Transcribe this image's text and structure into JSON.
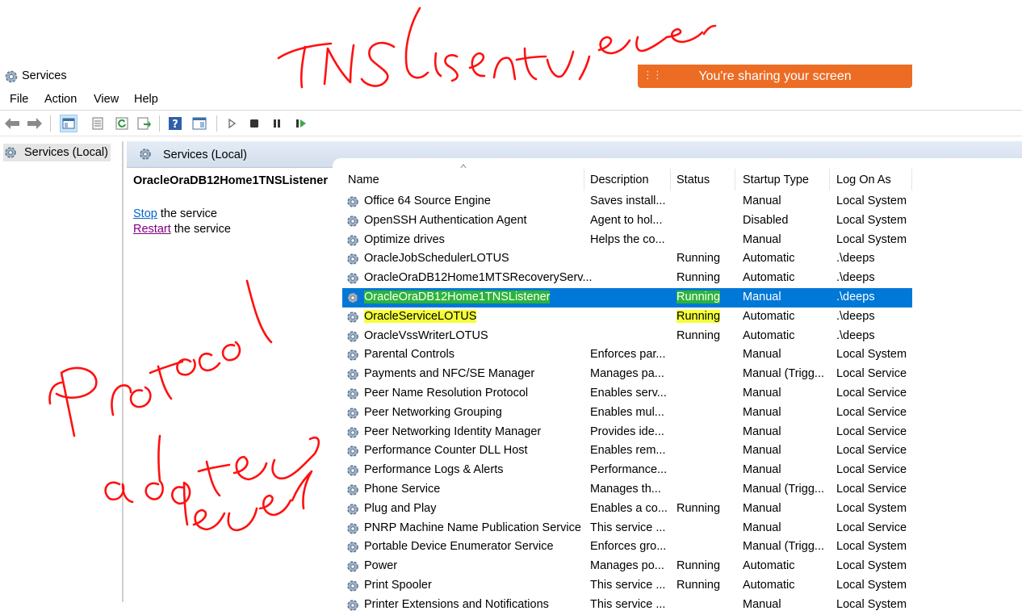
{
  "window": {
    "title": "Services"
  },
  "share_banner": {
    "text": "You're sharing your screen"
  },
  "menu": {
    "items": [
      "File",
      "Action",
      "View",
      "Help"
    ]
  },
  "tree": {
    "root": "Services (Local)"
  },
  "panel": {
    "title": "Services (Local)"
  },
  "extended": {
    "service_name": "OracleOraDB12Home1TNSListener",
    "stop_link": "Stop",
    "stop_suffix": " the service",
    "restart_link": "Restart",
    "restart_suffix": " the service"
  },
  "columns": [
    "Name",
    "Description",
    "Status",
    "Startup Type",
    "Log On As"
  ],
  "rows": [
    {
      "name": "Office 64 Source Engine",
      "desc": "Saves install...",
      "status": "",
      "startup": "Manual",
      "logon": "Local System"
    },
    {
      "name": "OpenSSH Authentication Agent",
      "desc": "Agent to hol...",
      "status": "",
      "startup": "Disabled",
      "logon": "Local System"
    },
    {
      "name": "Optimize drives",
      "desc": "Helps the co...",
      "status": "",
      "startup": "Manual",
      "logon": "Local System"
    },
    {
      "name": "OracleJobSchedulerLOTUS",
      "desc": "",
      "status": "Running",
      "startup": "Automatic",
      "logon": ".\\deeps"
    },
    {
      "name": "OracleOraDB12Home1MTSRecoveryServ...",
      "desc": "",
      "status": "Running",
      "startup": "Automatic",
      "logon": ".\\deeps"
    },
    {
      "name": "OracleOraDB12Home1TNSListener",
      "desc": "",
      "status": "Running",
      "startup": "Manual",
      "logon": ".\\deeps"
    },
    {
      "name": "OracleServiceLOTUS",
      "desc": "",
      "status": "Running",
      "startup": "Automatic",
      "logon": ".\\deeps"
    },
    {
      "name": "OracleVssWriterLOTUS",
      "desc": "",
      "status": "Running",
      "startup": "Automatic",
      "logon": ".\\deeps"
    },
    {
      "name": "Parental Controls",
      "desc": "Enforces par...",
      "status": "",
      "startup": "Manual",
      "logon": "Local System"
    },
    {
      "name": "Payments and NFC/SE Manager",
      "desc": "Manages pa...",
      "status": "",
      "startup": "Manual (Trigg...",
      "logon": "Local Service"
    },
    {
      "name": "Peer Name Resolution Protocol",
      "desc": "Enables serv...",
      "status": "",
      "startup": "Manual",
      "logon": "Local Service"
    },
    {
      "name": "Peer Networking Grouping",
      "desc": "Enables mul...",
      "status": "",
      "startup": "Manual",
      "logon": "Local Service"
    },
    {
      "name": "Peer Networking Identity Manager",
      "desc": "Provides ide...",
      "status": "",
      "startup": "Manual",
      "logon": "Local Service"
    },
    {
      "name": "Performance Counter DLL Host",
      "desc": "Enables rem...",
      "status": "",
      "startup": "Manual",
      "logon": "Local Service"
    },
    {
      "name": "Performance Logs & Alerts",
      "desc": "Performance...",
      "status": "",
      "startup": "Manual",
      "logon": "Local Service"
    },
    {
      "name": "Phone Service",
      "desc": "Manages th...",
      "status": "",
      "startup": "Manual (Trigg...",
      "logon": "Local Service"
    },
    {
      "name": "Plug and Play",
      "desc": "Enables a co...",
      "status": "Running",
      "startup": "Manual",
      "logon": "Local System"
    },
    {
      "name": "PNRP Machine Name Publication Service",
      "desc": "This service ...",
      "status": "",
      "startup": "Manual",
      "logon": "Local Service"
    },
    {
      "name": "Portable Device Enumerator Service",
      "desc": "Enforces gro...",
      "status": "",
      "startup": "Manual (Trigg...",
      "logon": "Local System"
    },
    {
      "name": "Power",
      "desc": "Manages po...",
      "status": "Running",
      "startup": "Automatic",
      "logon": "Local System"
    },
    {
      "name": "Print Spooler",
      "desc": "This service ...",
      "status": "Running",
      "startup": "Automatic",
      "logon": "Local System"
    },
    {
      "name": "Printer Extensions and Notifications",
      "desc": "This service ...",
      "status": "",
      "startup": "Manual",
      "logon": "Local System"
    }
  ],
  "selected_index": 5,
  "highlighted_index": 6,
  "icons": {
    "service": "gear-icon",
    "back": "back-arrow-icon",
    "forward": "forward-arrow-icon",
    "start": "play-icon",
    "stop": "stop-icon",
    "pause": "pause-icon",
    "resume": "resume-icon"
  },
  "colors": {
    "selection": "#0078d7",
    "banner": "#ec6c24",
    "ink": "#ff0000",
    "highlighter": "#f4ff3a"
  }
}
